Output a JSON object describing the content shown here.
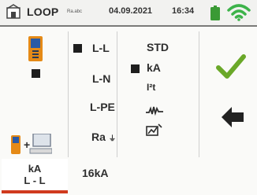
{
  "header": {
    "title": "LOOP",
    "subtitle": "Ra.abc",
    "date": "04.09.2021",
    "time": "16:34"
  },
  "left_panel": {
    "icons": [
      "meter-icon",
      "meter-plus-computer-icon"
    ]
  },
  "options_column_1": {
    "items": [
      "L-L",
      "L-N",
      "L-PE",
      "Ra"
    ],
    "selected": "L-L",
    "ra_suffix": "⏚"
  },
  "options_column_2": {
    "items": [
      "STD",
      "kA",
      "I²t"
    ],
    "selected": "kA",
    "extra_icons": [
      "waveform-icon",
      "speed-icon"
    ]
  },
  "actions": {
    "confirm_icon": "check-icon",
    "back_icon": "back-arrow-icon"
  },
  "bottom_bar": {
    "active_tab_line1": "kA",
    "active_tab_line2": "L - L",
    "value": "16kA"
  },
  "colors": {
    "accent_red": "#d03a1e",
    "check_green": "#6aa829",
    "battery_green": "#3a9a35",
    "wifi_green": "#3db34a",
    "icon_orange": "#e58a17",
    "icon_blue": "#2a5aa6"
  }
}
